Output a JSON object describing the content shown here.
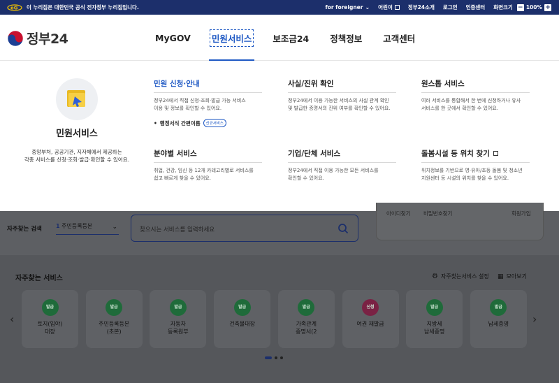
{
  "gov_banner": {
    "text": "이 누리집은 대한민국 공식 전자정부 누리집입니다.",
    "links": [
      "for foreigner",
      "어린이",
      "정부24소개",
      "로그인",
      "인증센터"
    ],
    "zoom_label": "화면크기",
    "zoom_minus": "−",
    "zoom_value": "100%",
    "zoom_plus": "+"
  },
  "header": {
    "logo_text": "정부24",
    "nav": [
      "MyGOV",
      "민원서비스",
      "보조금24",
      "정책정보",
      "고객센터"
    ],
    "active_nav": "민원서비스"
  },
  "dropdown": {
    "title": "민원서비스",
    "description_lines": [
      "중앙부처, 공공기관, 지자체에서 제공하는",
      "각종 서비스를 신청·조회·발급·확인할 수 있어요."
    ],
    "services": [
      {
        "title": "민원 신청·안내",
        "desc_lines": [
          "정부24에서 직접 신청·조회·발급 가능 서비스",
          "이용 및 정보를 확인할 수 있어요."
        ],
        "sub": "행정서식 간편이름",
        "badge": "신규서비스"
      },
      {
        "title": "사실/진위 확인",
        "desc_lines": [
          "정부24에서 이용 가능한 서비스의 사실 관계 확인",
          "및 발급한 증명서의 진위 여부를 확인할 수 있어요."
        ]
      },
      {
        "title": "원스톱 서비스",
        "desc_lines": [
          "여러 서비스를 통합해서 한 번에 신청하거나 유사",
          "서비스를 한 곳에서 확인할 수 있어요."
        ]
      },
      {
        "title": "분야별 서비스",
        "desc_lines": [
          "취업, 건강, 임신 등 12개 카테고리별로 서비스를",
          "쉽고 빠르게 찾을 수 있어요."
        ]
      },
      {
        "title": "기업/단체 서비스",
        "desc_lines": [
          "정부24에서 직접 이용 가능한 모든 서비스를",
          "확인할 수 있어요."
        ]
      },
      {
        "title": "돌봄시설 등 위치 찾기",
        "desc_lines": [
          "위치정보를 기반으로 영·유아/초등 돌봄 및 청소년",
          "지원센터 등 시설의 위치를 찾을 수 있어요."
        ]
      }
    ]
  },
  "search": {
    "label": "자주찾는 검색",
    "select_num": "1",
    "select_text": "주민등록등본",
    "placeholder": "찾으시는 서비스를 입력하세요"
  },
  "login_links": [
    "아이디찾기",
    "비밀번호찾기",
    "회원가입"
  ],
  "frequent": {
    "title": "자주찾는 서비스",
    "settings_label": "자주찾는서비스 설정",
    "all_label": "모아보기",
    "cards": [
      {
        "tag": "발급",
        "tag_color": "#1f6b3a",
        "line1": "토지(임야)",
        "line2": "대장"
      },
      {
        "tag": "발급",
        "tag_color": "#1f6b3a",
        "line1": "주민등록등본",
        "line2": "(초본)"
      },
      {
        "tag": "발급",
        "tag_color": "#1f6b3a",
        "line1": "자동차",
        "line2": "등록원부"
      },
      {
        "tag": "발급",
        "tag_color": "#1f6b3a",
        "line1": "건축물대장",
        "line2": ""
      },
      {
        "tag": "발급",
        "tag_color": "#1f6b3a",
        "line1": "가족관계",
        "line2": "증명서(2"
      },
      {
        "tag": "신청",
        "tag_color": "#7a2244",
        "line1": "여권 재발급",
        "line2": ""
      },
      {
        "tag": "발급",
        "tag_color": "#1f6b3a",
        "line1": "지방세",
        "line2": "납세증명"
      },
      {
        "tag": "발급",
        "tag_color": "#1f6b3a",
        "line1": "납세증명",
        "line2": ""
      }
    ]
  },
  "colors": {
    "gov_blue": "#1c2f6b",
    "accent_blue": "#1f59c4",
    "overlay": "#5d5f63"
  }
}
